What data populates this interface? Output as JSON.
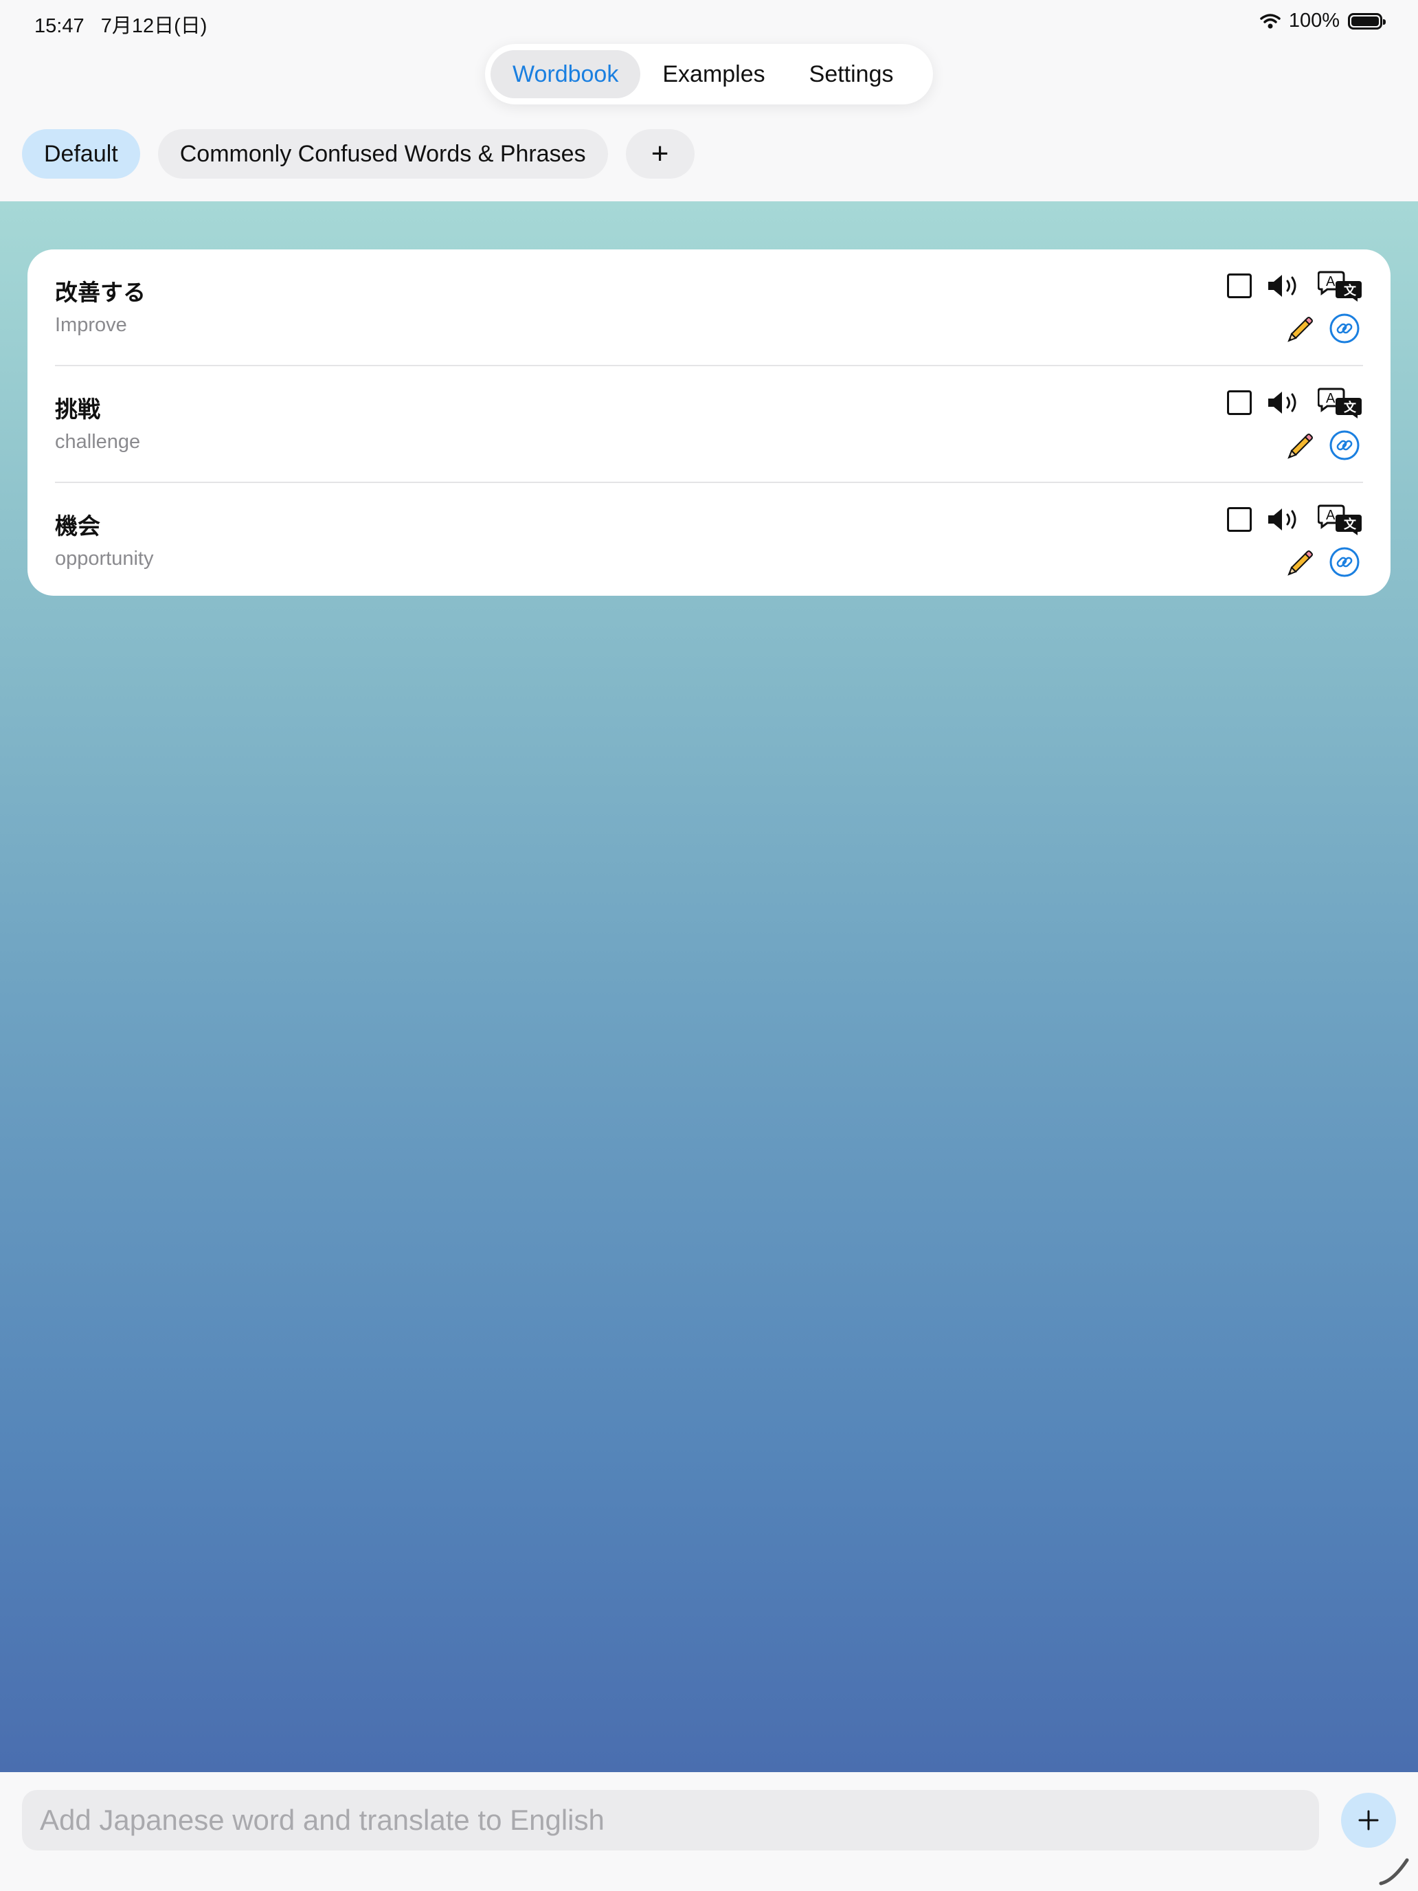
{
  "status_bar": {
    "time": "15:47   7月12日(日)",
    "battery": "100%"
  },
  "tabs": [
    {
      "label": "Wordbook",
      "active": true
    },
    {
      "label": "Examples",
      "active": false
    },
    {
      "label": "Settings",
      "active": false
    }
  ],
  "wordbooks": [
    {
      "label": "Default",
      "active": true
    },
    {
      "label": "Commonly Confused Words & Phrases",
      "active": false
    }
  ],
  "add_wordbook_label": "+",
  "words": [
    {
      "japanese": "改善する",
      "english": "Improve"
    },
    {
      "japanese": "挑戦",
      "english": "challenge"
    },
    {
      "japanese": "機会",
      "english": "opportunity"
    }
  ],
  "input": {
    "placeholder": "Add Japanese word and translate to English",
    "value": ""
  },
  "colors": {
    "accent": "#1a7fe0",
    "chip_active": "#cce6fb",
    "gradient_top": "#a6d8d6",
    "gradient_bottom": "#4a6eaf"
  },
  "icons": [
    "wifi-icon",
    "battery-icon",
    "checkbox-icon",
    "speaker-icon",
    "translate-icon",
    "pencil-icon",
    "link-icon",
    "plus-icon"
  ]
}
